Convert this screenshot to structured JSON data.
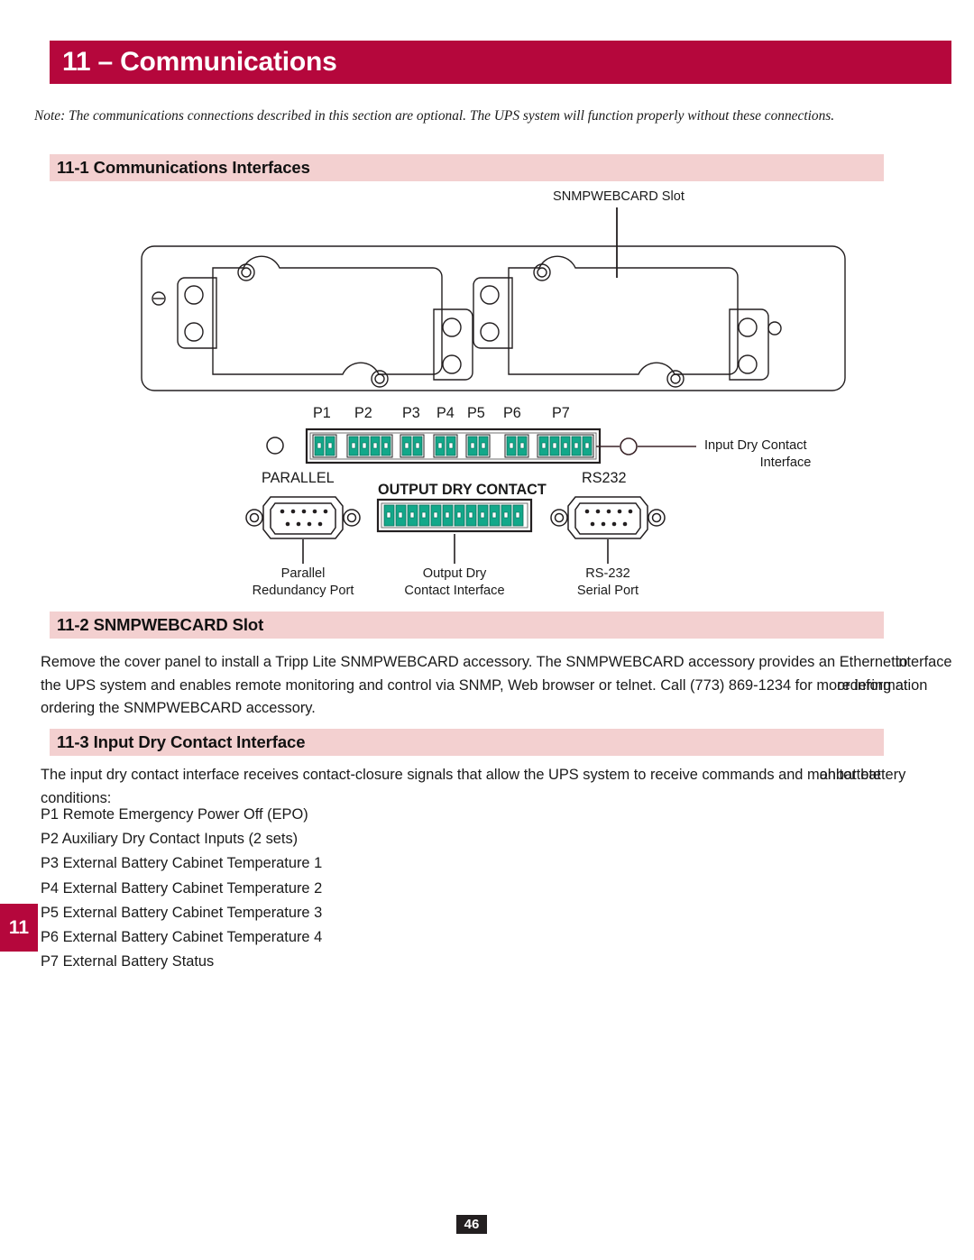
{
  "chapter": {
    "bar_title": "11 – Communications",
    "tab_number": "11"
  },
  "note": "Note: The communications connections described in this section are optional. The UPS system will function properly without these connections.",
  "sections": [
    {
      "id": "11-1",
      "title": "11-1 Communications Interfaces"
    },
    {
      "id": "11-2",
      "title": "11-2 SNMPWEBCARD Slot"
    },
    {
      "id": "11-3",
      "title": "11-3 Input Dry Contact Interface"
    }
  ],
  "figure": {
    "slot_callout": "SNMPWEBCARD Slot",
    "input_dry_contact_callout_line1": "Input Dry Contact",
    "input_dry_contact_callout_line2": "Interface",
    "pin_headers": [
      "P1",
      "P2",
      "P3",
      "P4",
      "P5",
      "P6",
      "P7"
    ],
    "pin_counts": [
      2,
      4,
      2,
      2,
      2,
      2,
      5
    ],
    "parallel_label": "PARALLEL",
    "output_dry_contact_label": "OUTPUT DRY CONTACT",
    "output_dry_contact_pins": 12,
    "rs232_label": "RS232",
    "parallel_caption_line1": "Parallel",
    "parallel_caption_line2": "Redundancy Port",
    "output_caption_line1": "Output Dry",
    "output_caption_line2": "Contact Interface",
    "rs232_caption_line1": "RS-232",
    "rs232_caption_line2": "Serial Port",
    "connector_green": "#13a88a",
    "line_color": "#231f20"
  },
  "snmp_paragraph": {
    "line1_main": "Remove the cover panel to install a Tripp Lite SNMPWEBCARD accessory. The SNMPWEBCARD accessory provides an Ethernet",
    "line1_overlap_a": "interface",
    "line1_overlap_b": "to",
    "line2_main": "the UPS system and enables remote monitoring and control via SNMP, Web browser or telnet. Call (773) 869-1234 for mo",
    "line2_overlap_a": "re information",
    "line2_overlap_b": "ordering at",
    "line3": "ordering the SNMPWEBCARD accessory."
  },
  "idc_paragraph": {
    "line1_main": "The input dry contact interface receives contact-closure signals that allow the UPS system to receive commands and m",
    "line1_overlap_a": "onitor battery",
    "line1_overlap_b": "ahbattete",
    "line2": "conditions:"
  },
  "p_list": [
    "P1 Remote Emergency Power Off (EPO)",
    "P2 Auxiliary Dry Contact Inputs (2 sets)",
    "P3 External Battery Cabinet Temperature 1",
    "P4 External Battery Cabinet Temperature 2",
    "P5 External Battery Cabinet Temperature 3",
    "P6 External Battery Cabinet Temperature 4",
    "P7 External Battery Status"
  ],
  "footer": {
    "page_number": "46"
  },
  "colors": {
    "crimson": "#b5073c",
    "pink": "#f3d0d0",
    "dark": "#231f20"
  }
}
